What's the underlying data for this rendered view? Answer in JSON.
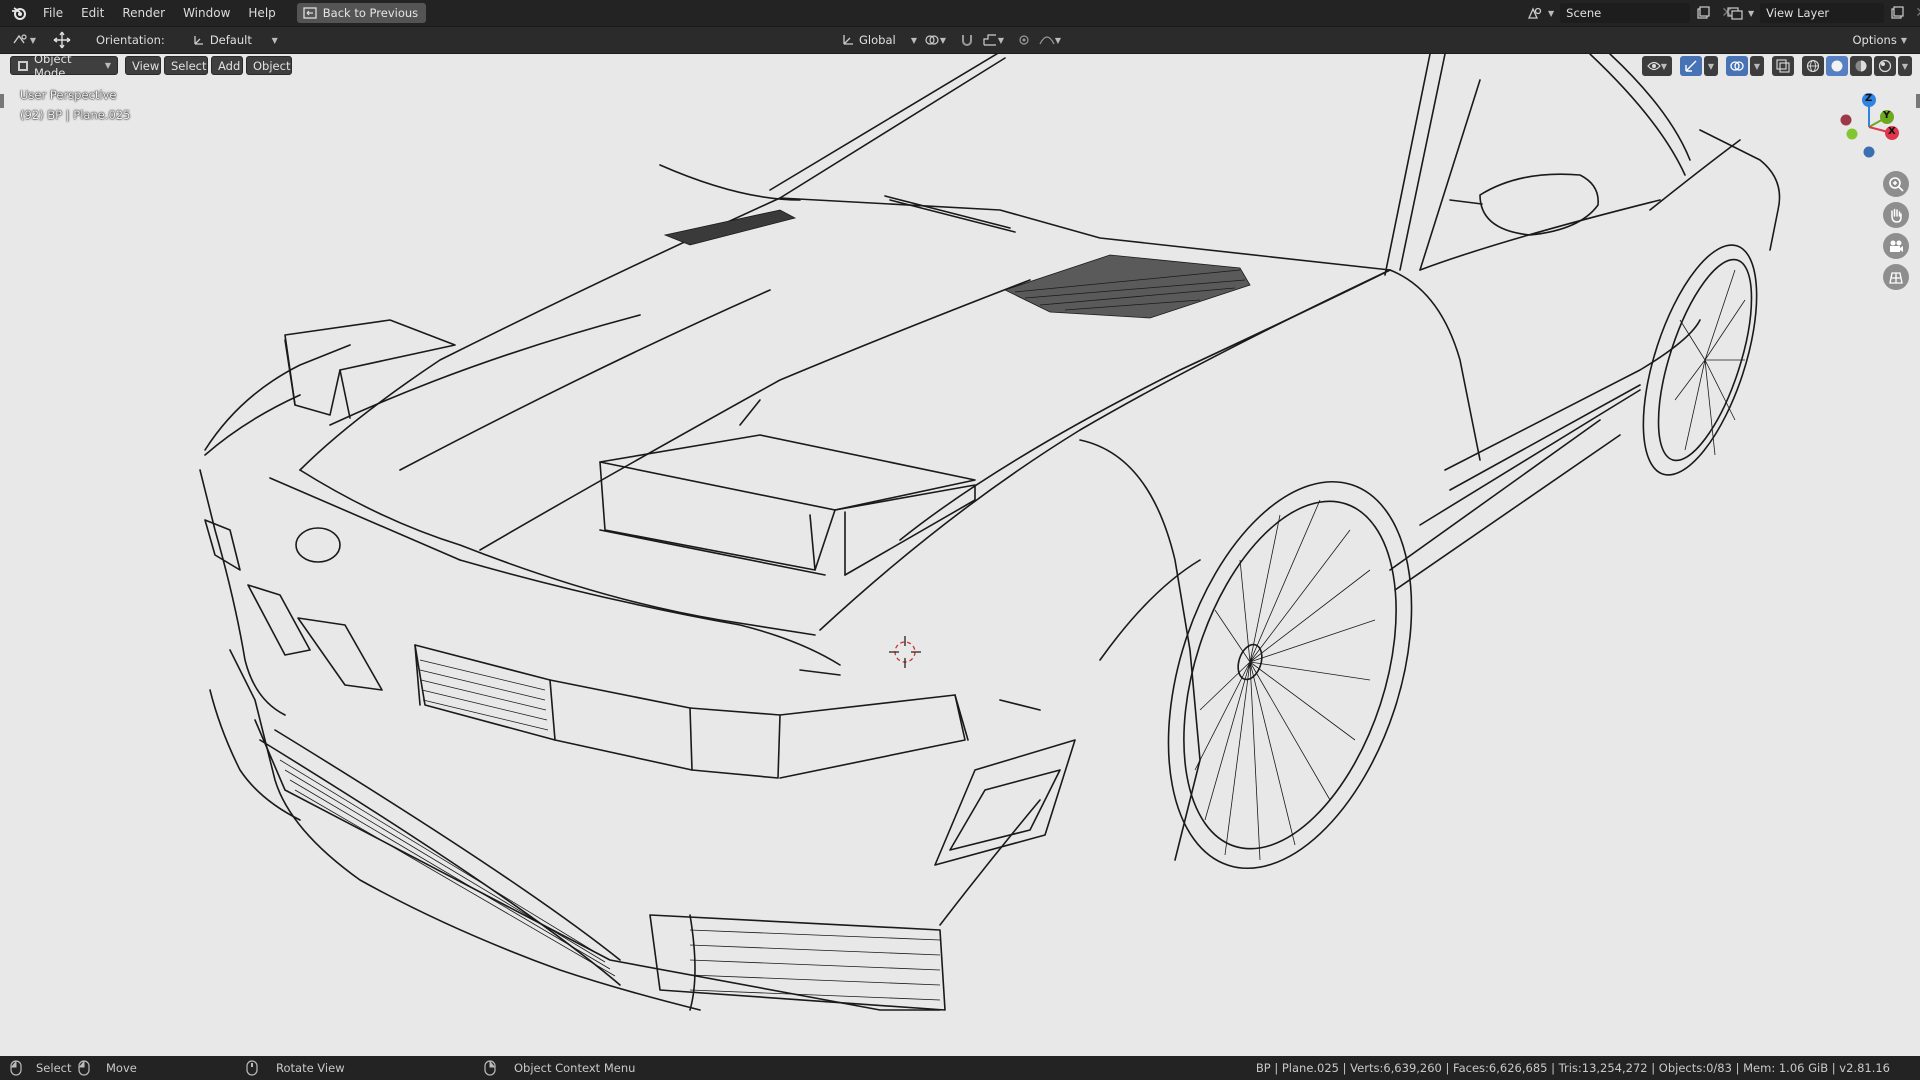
{
  "topbar": {
    "menus": [
      "File",
      "Edit",
      "Render",
      "Window",
      "Help"
    ],
    "back_label": "Back to Previous",
    "scene_label": "Scene",
    "view_layer_label": "View Layer"
  },
  "toolheader": {
    "orientation_label": "Orientation:",
    "orientation_value": "Default",
    "transform_space": "Global",
    "options_label": "Options"
  },
  "viewport": {
    "mode": "Object Mode",
    "menus": [
      "View",
      "Select",
      "Add",
      "Object"
    ],
    "perspective_text": "User Perspective",
    "object_text": "(92) BP | Plane.025",
    "gizmo": {
      "z": "Z",
      "y": "Y",
      "x": "X"
    }
  },
  "statusbar": {
    "select": "Select",
    "move": "Move",
    "rotate": "Rotate View",
    "context_menu": "Object Context Menu",
    "stats": "BP | Plane.025 | Verts:6,639,260 | Faces:6,626,685 | Tris:13,254,272 | Objects:0/83 | Mem: 1.06 GiB | v2.81.16"
  },
  "colors": {
    "header_bg": "#232323",
    "viewport_bg": "#e8e8e8",
    "axis_x": "#e0364b",
    "axis_y": "#6ea81f",
    "axis_z": "#2f83e3"
  }
}
